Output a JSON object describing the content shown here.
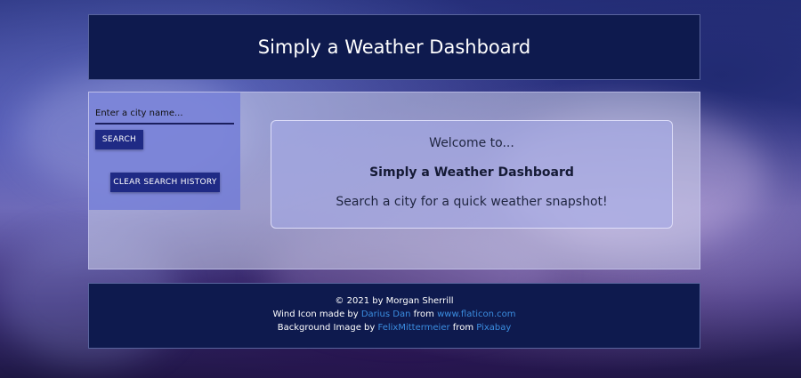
{
  "header": {
    "title": "Simply a Weather Dashboard"
  },
  "sidebar": {
    "search_placeholder": "Enter a city name...",
    "search_button": "SEARCH",
    "clear_button": "CLEAR SEARCH HISTORY"
  },
  "welcome": {
    "line1": "Welcome to...",
    "line2": "Simply a Weather Dashboard",
    "line3": "Search a city for a quick weather snapshot!"
  },
  "footer": {
    "copyright": "© 2021 by Morgan Sherrill",
    "icon_prefix": "Wind Icon made by ",
    "icon_author": "Darius Dan",
    "icon_from": " from ",
    "icon_site": "www.flaticon.com",
    "bg_prefix": "Background Image by ",
    "bg_author": "FelixMittermeier",
    "bg_from": " from ",
    "bg_site": "Pixabay"
  },
  "colors": {
    "header_bg": "#0e1a4e",
    "button_bg": "#1f2a85",
    "link": "#3b8de0"
  }
}
